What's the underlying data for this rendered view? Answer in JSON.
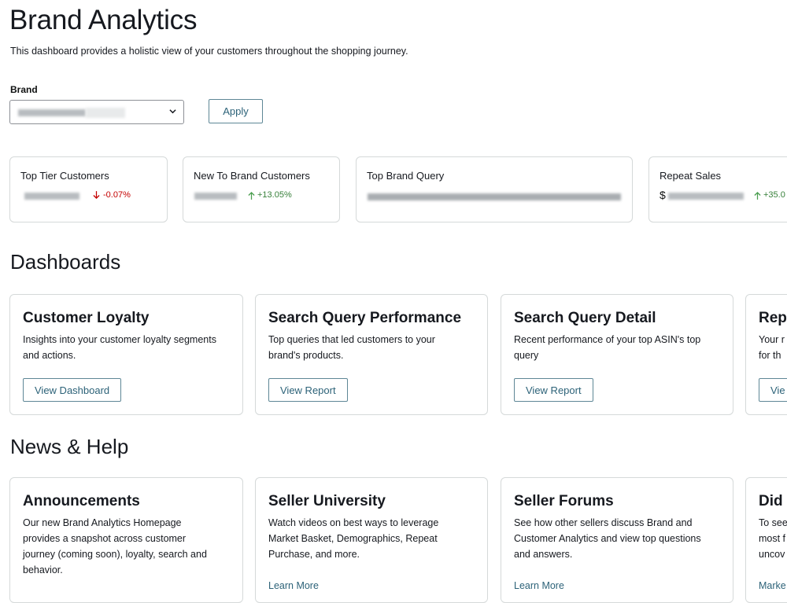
{
  "page": {
    "title": "Brand Analytics",
    "subtitle": "This dashboard provides a holistic view of your customers throughout the shopping journey."
  },
  "brand_filter": {
    "label": "Brand",
    "apply_label": "Apply"
  },
  "metrics": [
    {
      "title": "Top Tier Customers",
      "delta": "-0.07%",
      "direction": "down"
    },
    {
      "title": "New To Brand Customers",
      "delta": "+13.05%",
      "direction": "up"
    },
    {
      "title": "Top Brand Query"
    },
    {
      "title": "Repeat Sales",
      "value_prefix": "$",
      "delta": "+35.0",
      "direction": "up"
    }
  ],
  "dashboards": {
    "heading": "Dashboards",
    "cards": [
      {
        "title": "Customer Loyalty",
        "description": "Insights into your customer loyalty segments and actions.",
        "button": "View Dashboard"
      },
      {
        "title": "Search Query Performance",
        "description": "Top queries that led customers to your brand's products.",
        "button": "View Report"
      },
      {
        "title": "Search Query Detail",
        "description": "Recent performance of your top ASIN's top query",
        "button": "View Report"
      },
      {
        "title": "Rep",
        "description": "Your r for th",
        "button": "Vie"
      }
    ]
  },
  "news": {
    "heading": "News & Help",
    "cards": [
      {
        "title": "Announcements",
        "description": "Our new Brand Analytics Homepage provides a snapshot across customer journey (coming soon), loyalty, search and behavior."
      },
      {
        "title": "Seller University",
        "description": "Watch videos on best ways to leverage Market Basket, Demographics, Repeat Purchase, and more.",
        "link": "Learn More"
      },
      {
        "title": "Seller Forums",
        "description": "See how other sellers discuss Brand and Customer Analytics and view top questions and answers.",
        "link": "Learn More"
      },
      {
        "title": "Did",
        "description": "To see most f uncov",
        "link": "Marke"
      }
    ]
  },
  "icons": {
    "select": "chevron-down-icon",
    "delta_down": "arrow-down-icon",
    "delta_up": "arrow-up-icon"
  },
  "colors": {
    "link": "#2c6278",
    "positive": "#37803a",
    "negative": "#c40000",
    "border": "#d5d9d9"
  }
}
